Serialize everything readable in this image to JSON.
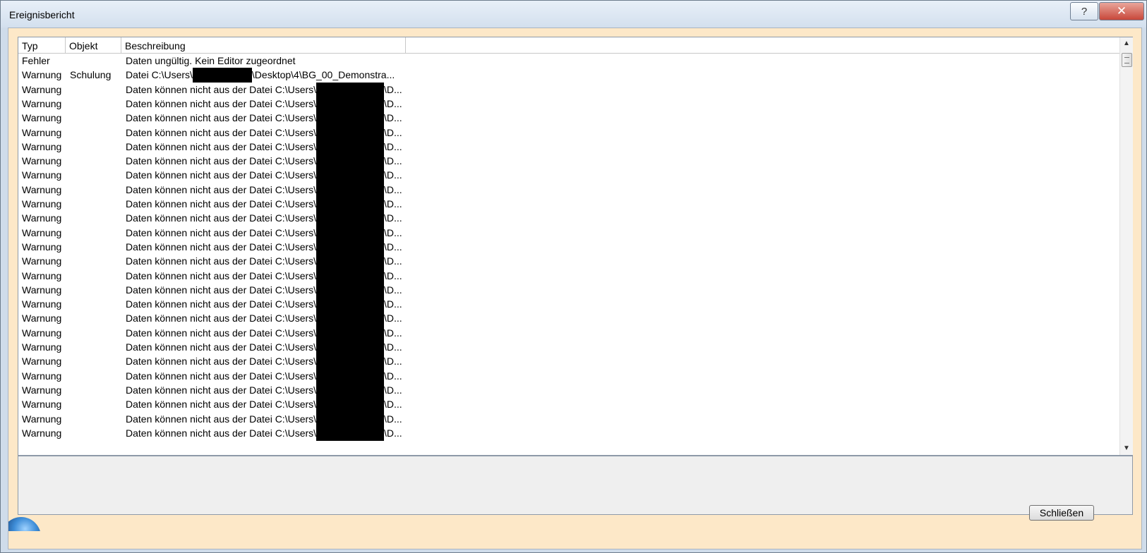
{
  "window": {
    "title": "Ereignisbericht",
    "help_glyph": "?",
    "close_glyph": "✕"
  },
  "table": {
    "columns": [
      "Typ",
      "Objekt",
      "Beschreibung"
    ],
    "rows": [
      {
        "typ": "Fehler",
        "objekt": "",
        "beschreibung": "Daten ungültig. Kein Editor zugeordnet"
      },
      {
        "typ": "Warnung",
        "objekt": "Schulung",
        "beschreibung": "Datei C:\\Users\\",
        "suffix": "\\Desktop\\4\\BG_00_Demonstra..."
      },
      {
        "typ": "Warnung",
        "objekt": "",
        "beschreibung": "Daten können nicht aus der Datei C:\\Users\\",
        "suffix": "\\D..."
      },
      {
        "typ": "Warnung",
        "objekt": "",
        "beschreibung": "Daten können nicht aus der Datei C:\\Users\\",
        "suffix": "\\D..."
      },
      {
        "typ": "Warnung",
        "objekt": "",
        "beschreibung": "Daten können nicht aus der Datei C:\\Users\\",
        "suffix": "\\D..."
      },
      {
        "typ": "Warnung",
        "objekt": "",
        "beschreibung": "Daten können nicht aus der Datei C:\\Users\\",
        "suffix": "\\D..."
      },
      {
        "typ": "Warnung",
        "objekt": "",
        "beschreibung": "Daten können nicht aus der Datei C:\\Users\\",
        "suffix": "\\D..."
      },
      {
        "typ": "Warnung",
        "objekt": "",
        "beschreibung": "Daten können nicht aus der Datei C:\\Users\\",
        "suffix": "\\D..."
      },
      {
        "typ": "Warnung",
        "objekt": "",
        "beschreibung": "Daten können nicht aus der Datei C:\\Users\\",
        "suffix": "\\D..."
      },
      {
        "typ": "Warnung",
        "objekt": "",
        "beschreibung": "Daten können nicht aus der Datei C:\\Users\\",
        "suffix": "\\D..."
      },
      {
        "typ": "Warnung",
        "objekt": "",
        "beschreibung": "Daten können nicht aus der Datei C:\\Users\\",
        "suffix": "\\D..."
      },
      {
        "typ": "Warnung",
        "objekt": "",
        "beschreibung": "Daten können nicht aus der Datei C:\\Users\\",
        "suffix": "\\D..."
      },
      {
        "typ": "Warnung",
        "objekt": "",
        "beschreibung": "Daten können nicht aus der Datei C:\\Users\\",
        "suffix": "\\D..."
      },
      {
        "typ": "Warnung",
        "objekt": "",
        "beschreibung": "Daten können nicht aus der Datei C:\\Users\\",
        "suffix": "\\D..."
      },
      {
        "typ": "Warnung",
        "objekt": "",
        "beschreibung": "Daten können nicht aus der Datei C:\\Users\\",
        "suffix": "\\D..."
      },
      {
        "typ": "Warnung",
        "objekt": "",
        "beschreibung": "Daten können nicht aus der Datei C:\\Users\\",
        "suffix": "\\D..."
      },
      {
        "typ": "Warnung",
        "objekt": "",
        "beschreibung": "Daten können nicht aus der Datei C:\\Users\\",
        "suffix": "\\D..."
      },
      {
        "typ": "Warnung",
        "objekt": "",
        "beschreibung": "Daten können nicht aus der Datei C:\\Users\\",
        "suffix": "\\D..."
      },
      {
        "typ": "Warnung",
        "objekt": "",
        "beschreibung": "Daten können nicht aus der Datei C:\\Users\\",
        "suffix": "\\D..."
      },
      {
        "typ": "Warnung",
        "objekt": "",
        "beschreibung": "Daten können nicht aus der Datei C:\\Users\\",
        "suffix": "\\D..."
      },
      {
        "typ": "Warnung",
        "objekt": "",
        "beschreibung": "Daten können nicht aus der Datei C:\\Users\\",
        "suffix": "\\D..."
      },
      {
        "typ": "Warnung",
        "objekt": "",
        "beschreibung": "Daten können nicht aus der Datei C:\\Users\\",
        "suffix": "\\D..."
      },
      {
        "typ": "Warnung",
        "objekt": "",
        "beschreibung": "Daten können nicht aus der Datei C:\\Users\\",
        "suffix": "\\D..."
      },
      {
        "typ": "Warnung",
        "objekt": "",
        "beschreibung": "Daten können nicht aus der Datei C:\\Users\\",
        "suffix": "\\D..."
      },
      {
        "typ": "Warnung",
        "objekt": "",
        "beschreibung": "Daten können nicht aus der Datei C:\\Users\\",
        "suffix": "\\D..."
      },
      {
        "typ": "Warnung",
        "objekt": "",
        "beschreibung": "Daten können nicht aus der Datei C:\\Users\\",
        "suffix": "\\D..."
      },
      {
        "typ": "Warnung",
        "objekt": "",
        "beschreibung": "Daten können nicht aus der Datei C:\\Users\\",
        "suffix": "\\D..."
      }
    ]
  },
  "scrollbar": {
    "up_glyph": "▲",
    "down_glyph": "▼"
  },
  "footer": {
    "close_label": "Schließen"
  },
  "colors": {
    "client_bg": "#fde8c8",
    "redaction": "#000000"
  }
}
